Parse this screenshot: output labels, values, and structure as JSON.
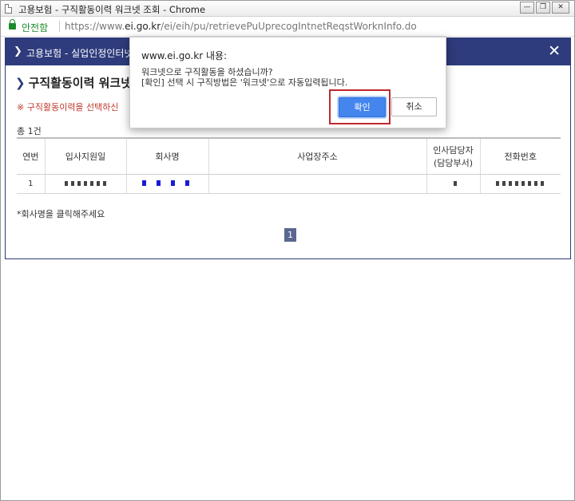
{
  "window": {
    "title": "고용보험 - 구직활동이력 워크넷 조회 - Chrome",
    "buttons": {
      "minimize": "—",
      "restore": "❐",
      "close": "✕"
    }
  },
  "addressbar": {
    "secure_label": "안전함",
    "url_prefix": "https://www.",
    "url_host": "ei.go.kr",
    "url_path": "/ei/eih/pu/retrievePuUprecogIntnetReqstWorknInfo.do"
  },
  "page": {
    "header_title": "고용보험 - 실업인정인터넷",
    "close_icon": "✕",
    "section_title": "구직활동이력 워크넷",
    "notice": "※ 구직활동이력을 선택하신",
    "total": "총 1건",
    "table": {
      "headers": [
        "연번",
        "입사지원일",
        "회사명",
        "사업장주소",
        "인사담당자\n(담당부서)",
        "전화번호"
      ],
      "header_person_line1": "인사담당자",
      "header_person_line2": "(담당부서)",
      "rows": [
        {
          "seq": "1"
        }
      ]
    },
    "hint": "*회사명을 클릭해주세요",
    "pager_current": "1"
  },
  "dialog": {
    "title": "www.ei.go.kr 내용:",
    "message_line1": "워크넷으로 구직활동을 하셨습니까?",
    "message_line2": "[확인] 선택 시 구직방법은 '워크넷'으로 자동입력됩니다.",
    "ok_label": "확인",
    "cancel_label": "취소",
    "highlight_color": "#c0282d"
  }
}
